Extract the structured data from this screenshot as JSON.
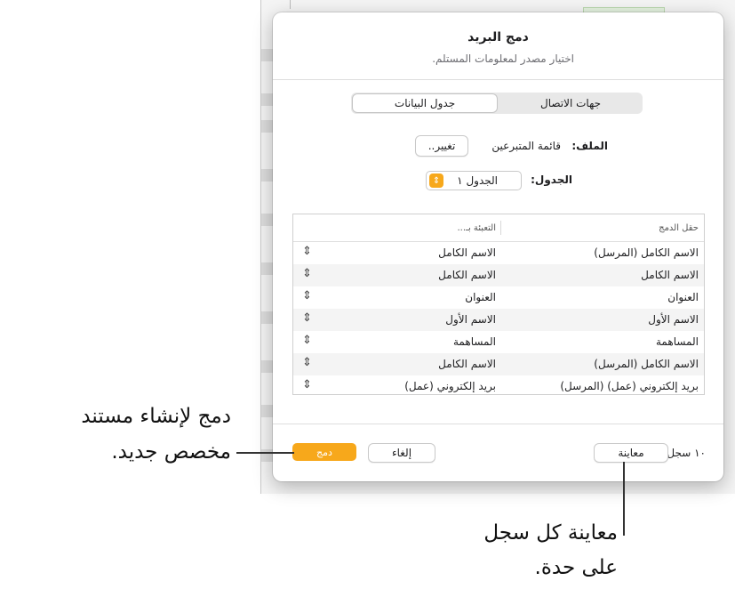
{
  "dialog": {
    "title": "دمج البريد",
    "subtitle": "اختيار مصدر لمعلومات المستلم."
  },
  "source_tabs": [
    {
      "label": "جهات الاتصال",
      "active": false
    },
    {
      "label": "جدول البيانات",
      "active": true
    }
  ],
  "file": {
    "label": "الملف:",
    "value": "قائمة المتبرعين",
    "change_button": "تغيير.."
  },
  "table_select": {
    "label": "الجدول:",
    "value": "الجدول ١"
  },
  "mapping_table": {
    "headers": {
      "field": "حقل الدمج",
      "fill": "التعبئة بـ..."
    },
    "rows": [
      {
        "field": "الاسم الكامل (المرسل)",
        "fill": "الاسم الكامل"
      },
      {
        "field": "الاسم الكامل",
        "fill": "الاسم الكامل"
      },
      {
        "field": "العنوان",
        "fill": "العنوان"
      },
      {
        "field": "الاسم الأول",
        "fill": "الاسم الأول"
      },
      {
        "field": "المساهمة",
        "fill": "المساهمة"
      },
      {
        "field": "الاسم الكامل (المرسل)",
        "fill": "الاسم الكامل"
      },
      {
        "field": "بريد إلكتروني (عمل) (المرسل)",
        "fill": "بريد إلكتروني (عمل)"
      }
    ]
  },
  "footer": {
    "record_count": "١٠ سجل",
    "preview_button": "معاينة",
    "cancel_button": "إلغاء",
    "merge_button": "دمج"
  },
  "callouts": {
    "merge_line1": "دمج لإنشاء مستند",
    "merge_line2": "مخصص جديد.",
    "preview_line1": "معاينة كل سجل",
    "preview_line2": "على حدة."
  },
  "colors": {
    "accent": "#f7a81b"
  }
}
